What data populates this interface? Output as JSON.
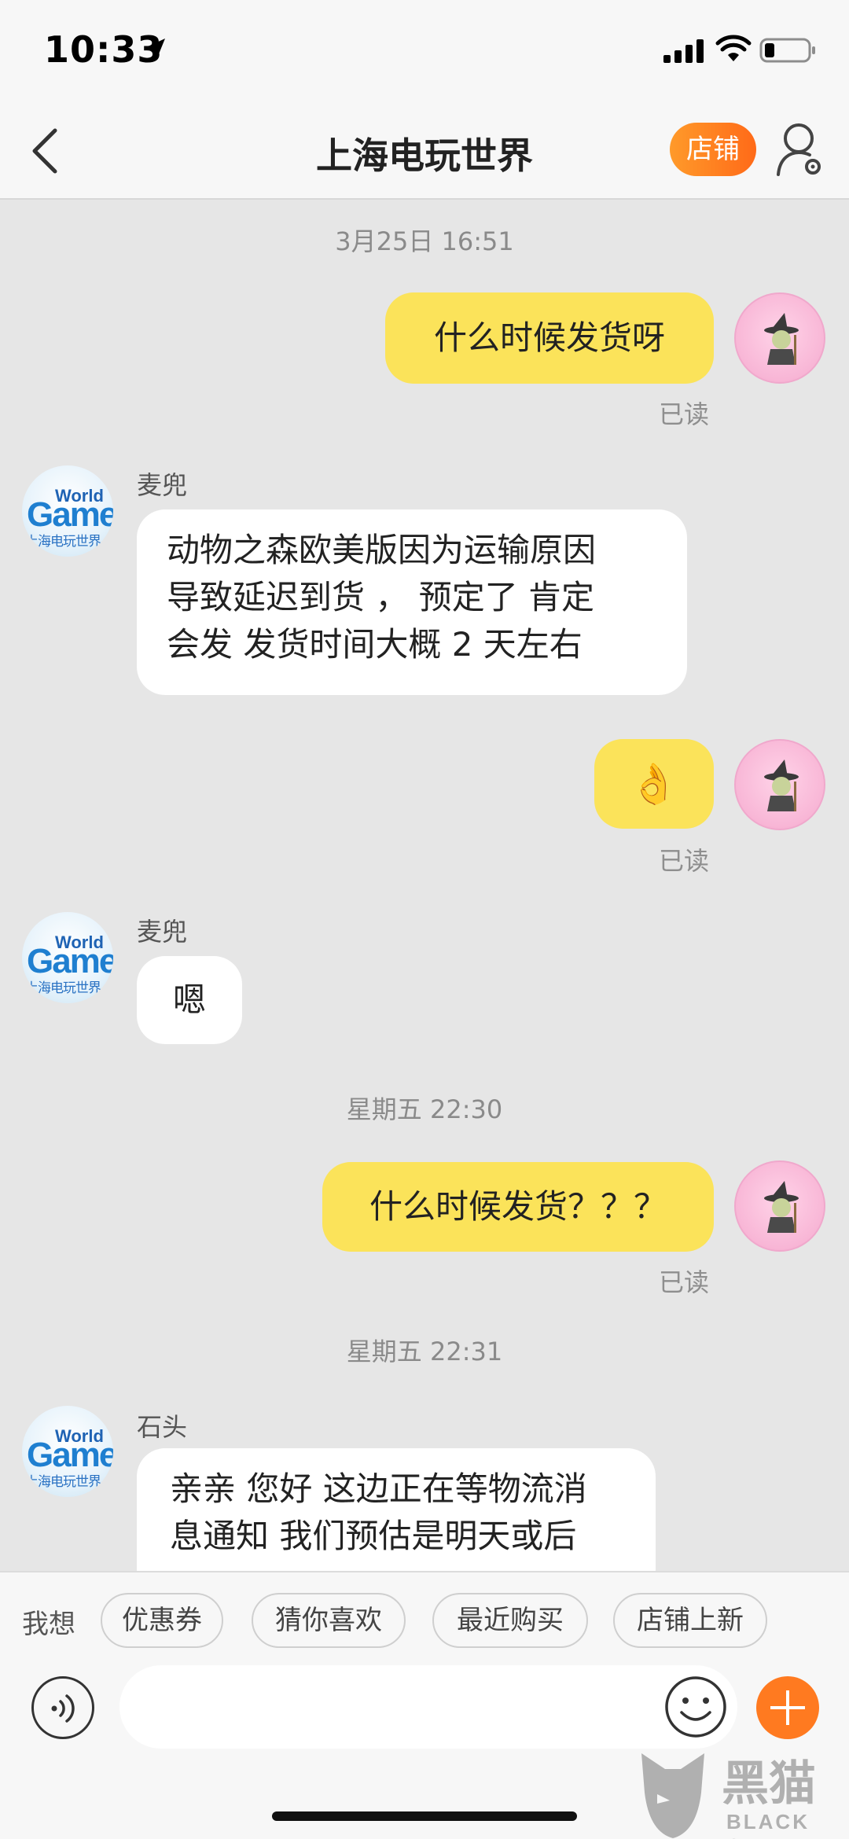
{
  "status_bar": {
    "time": "10:33"
  },
  "header": {
    "title": "上海电玩世界",
    "store_button": "店铺"
  },
  "timestamps": [
    "3月25日 16:51",
    "星期五 22:30",
    "星期五 22:31"
  ],
  "shop_avatar": {
    "line1": "World",
    "line2": "Game",
    "line3": "上海电玩世界"
  },
  "messages": [
    {
      "from": "me",
      "text": "什么时候发货呀",
      "read": "已读"
    },
    {
      "from": "shop",
      "sender": "麦兜",
      "lines": [
        "动物之森欧美版因为运输原因",
        "导致延迟到货 ， 预定了 肯定",
        "会发  发货时间大概 2 天左右"
      ]
    },
    {
      "from": "me",
      "text": "👌",
      "read": "已读"
    },
    {
      "from": "shop",
      "sender": "麦兜",
      "text": "嗯"
    },
    {
      "from": "me",
      "text": "什么时候发货？？？",
      "read": "已读"
    },
    {
      "from": "shop",
      "sender": "石头",
      "lines": [
        "亲亲 您好 这边正在等物流消",
        "息通知 我们预估是明天或后"
      ]
    }
  ],
  "quick_bar": {
    "label": "我想",
    "chips": [
      "优惠券",
      "猜你喜欢",
      "最近购买",
      "店铺上新"
    ]
  },
  "input": {
    "placeholder": ""
  },
  "watermark": {
    "title": "黑猫",
    "subtitle": "BLACK CAT"
  },
  "colors": {
    "my_bubble": "#fbe35a",
    "shop_bubble": "#ffffff",
    "accent": "#ff7a20"
  },
  "icons": [
    "location-arrow-icon",
    "signal-icon",
    "wifi-icon",
    "battery-icon",
    "back-icon",
    "user-settings-icon",
    "voice-icon",
    "emoji-icon",
    "plus-icon"
  ]
}
